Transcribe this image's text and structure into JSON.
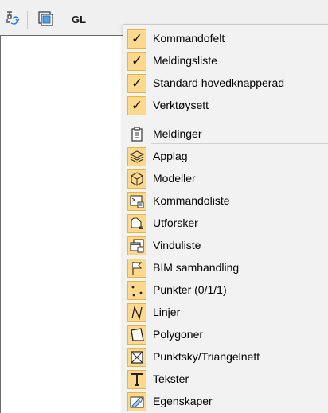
{
  "toolbar": {
    "button1_icon": "network-cycle-icon",
    "button2_icon": "layers-frame-icon",
    "gl_label": "GL"
  },
  "menu": {
    "checked_items": [
      {
        "label": "Kommandofelt",
        "checked": true
      },
      {
        "label": "Meldingsliste",
        "checked": true
      },
      {
        "label": "Standard hovedknapperad",
        "checked": true
      },
      {
        "label": "Verktøysett",
        "checked": true
      }
    ],
    "items": [
      {
        "label": "Meldinger",
        "icon": "clipboard-icon"
      },
      {
        "label": "Applag",
        "icon": "layers-icon"
      },
      {
        "label": "Modeller",
        "icon": "cube-icon"
      },
      {
        "label": "Kommandoliste",
        "icon": "command-list-icon"
      },
      {
        "label": "Utforsker",
        "icon": "explorer-icon"
      },
      {
        "label": "Vinduliste",
        "icon": "window-list-icon"
      },
      {
        "label": "BIM samhandling",
        "icon": "flag-icon"
      },
      {
        "label": "Punkter (0/1/1)",
        "icon": "points-icon"
      },
      {
        "label": "Linjer",
        "icon": "lines-icon"
      },
      {
        "label": "Polygoner",
        "icon": "polygon-icon"
      },
      {
        "label": "Punktsky/Triangelnett",
        "icon": "triangle-mesh-icon"
      },
      {
        "label": "Tekster",
        "icon": "text-icon"
      },
      {
        "label": "Egenskaper",
        "icon": "properties-icon"
      }
    ]
  },
  "colors": {
    "check_bg": "#ffd98b",
    "check_border": "#e6b54a",
    "menu_bg": "#f2f2f2"
  }
}
